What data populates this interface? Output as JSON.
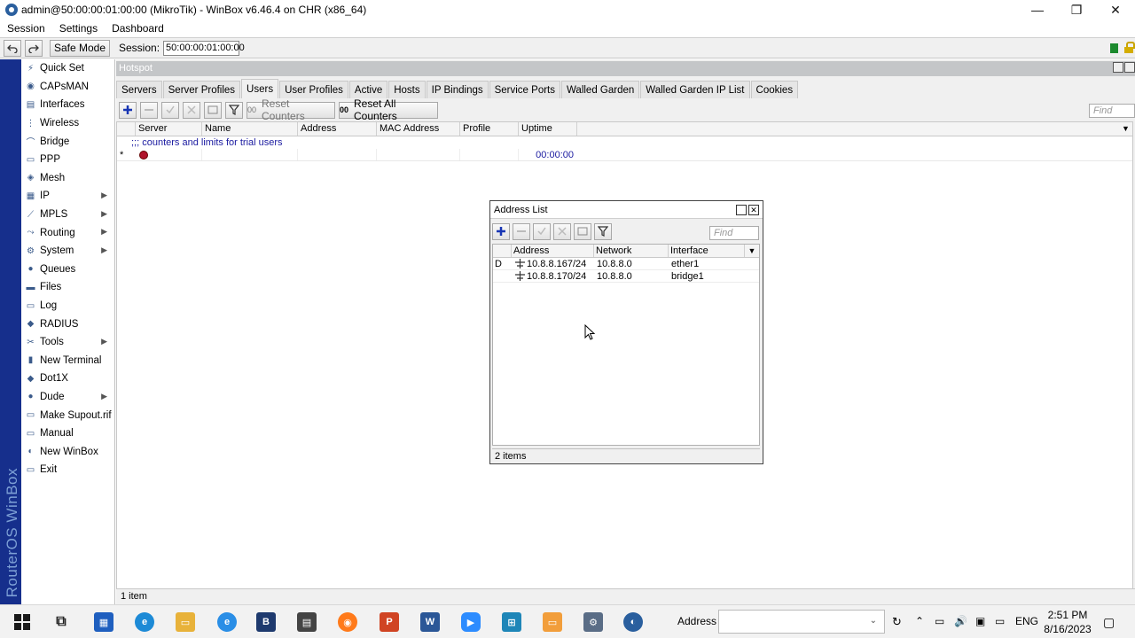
{
  "window": {
    "title": "admin@50:00:00:01:00:00 (MikroTik) - WinBox v6.46.4 on CHR (x86_64)",
    "minimize": "—",
    "maximize": "❐",
    "close": "✕"
  },
  "menu": [
    "Session",
    "Settings",
    "Dashboard"
  ],
  "toolbar": {
    "safe_mode": "Safe Mode",
    "session_label": "Session:",
    "session_value": "50:00:00:01:00:00"
  },
  "brand": "RouterOS WinBox",
  "sidebar": {
    "items": [
      {
        "label": "Quick Set",
        "icon": "quick-set-icon",
        "submenu": false
      },
      {
        "label": "CAPsMAN",
        "icon": "capsman-icon",
        "submenu": false
      },
      {
        "label": "Interfaces",
        "icon": "interfaces-icon",
        "submenu": false
      },
      {
        "label": "Wireless",
        "icon": "wireless-icon",
        "submenu": false
      },
      {
        "label": "Bridge",
        "icon": "bridge-icon",
        "submenu": false
      },
      {
        "label": "PPP",
        "icon": "ppp-icon",
        "submenu": false
      },
      {
        "label": "Mesh",
        "icon": "mesh-icon",
        "submenu": false
      },
      {
        "label": "IP",
        "icon": "ip-icon",
        "submenu": true
      },
      {
        "label": "MPLS",
        "icon": "mpls-icon",
        "submenu": true
      },
      {
        "label": "Routing",
        "icon": "routing-icon",
        "submenu": true
      },
      {
        "label": "System",
        "icon": "system-icon",
        "submenu": true
      },
      {
        "label": "Queues",
        "icon": "queues-icon",
        "submenu": false
      },
      {
        "label": "Files",
        "icon": "files-icon",
        "submenu": false
      },
      {
        "label": "Log",
        "icon": "log-icon",
        "submenu": false
      },
      {
        "label": "RADIUS",
        "icon": "radius-icon",
        "submenu": false
      },
      {
        "label": "Tools",
        "icon": "tools-icon",
        "submenu": true
      },
      {
        "label": "New Terminal",
        "icon": "terminal-icon",
        "submenu": false
      },
      {
        "label": "Dot1X",
        "icon": "dot1x-icon",
        "submenu": false
      },
      {
        "label": "Dude",
        "icon": "dude-icon",
        "submenu": true
      },
      {
        "label": "Make Supout.rif",
        "icon": "supout-icon",
        "submenu": false
      },
      {
        "label": "Manual",
        "icon": "manual-icon",
        "submenu": false
      },
      {
        "label": "New WinBox",
        "icon": "winbox-icon",
        "submenu": false
      },
      {
        "label": "Exit",
        "icon": "exit-icon",
        "submenu": false
      }
    ],
    "arrow": "▶"
  },
  "hotspot": {
    "title": "Hotspot",
    "tabs": [
      "Servers",
      "Server Profiles",
      "Users",
      "User Profiles",
      "Active",
      "Hosts",
      "IP Bindings",
      "Service Ports",
      "Walled Garden",
      "Walled Garden IP List",
      "Cookies"
    ],
    "active_tab": "Users",
    "reset_counters": "Reset Counters",
    "reset_all_counters": "Reset All Counters",
    "counter_prefix": "00",
    "find_placeholder": "Find",
    "columns": [
      "Server",
      "Name",
      "Address",
      "MAC Address",
      "Profile",
      "Uptime"
    ],
    "comment": ";;; counters and limits for trial users",
    "row": {
      "flag": "*",
      "uptime": "00:00:00"
    },
    "status": "1 item"
  },
  "address_list": {
    "title": "Address List",
    "find_placeholder": "Find",
    "columns": [
      "Address",
      "Network",
      "Interface"
    ],
    "rows": [
      {
        "flag": "D",
        "address": "10.8.8.167/24",
        "network": "10.8.8.0",
        "interface": "ether1"
      },
      {
        "flag": "",
        "address": "10.8.8.170/24",
        "network": "10.8.8.0",
        "interface": "bridge1"
      }
    ],
    "status": "2 items"
  },
  "taskbar": {
    "address_label": "Address",
    "lang": "ENG",
    "time": "2:51 PM",
    "date": "8/16/2023"
  }
}
